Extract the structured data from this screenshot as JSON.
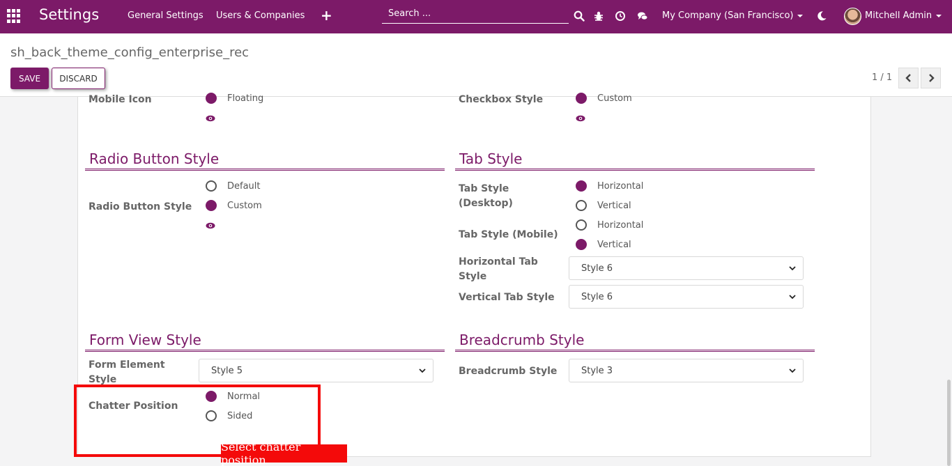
{
  "navbar": {
    "app_title": "Settings",
    "links": [
      "General Settings",
      "Users & Companies"
    ],
    "search_placeholder": "Search ...",
    "company": "My Company (San Francisco)",
    "user": "Mitchell Admin"
  },
  "control_panel": {
    "record_title": "sh_back_theme_config_enterprise_rec",
    "save_label": "SAVE",
    "discard_label": "DISCARD",
    "pager": "1 / 1"
  },
  "top_partial": {
    "left": {
      "label": "Mobile Icon",
      "option": "Floating"
    },
    "right": {
      "label": "Checkbox Style",
      "option": "Custom"
    }
  },
  "radio_section": {
    "title": "Radio Button Style",
    "label": "Radio Button Style",
    "options": [
      "Default",
      "Custom"
    ],
    "selected": "Custom"
  },
  "tab_section": {
    "title": "Tab Style",
    "desktop_label_1": "Tab Style",
    "desktop_label_2": "(Desktop)",
    "desktop_options": [
      "Horizontal",
      "Vertical"
    ],
    "desktop_selected": "Horizontal",
    "mobile_label": "Tab Style (Mobile)",
    "mobile_options": [
      "Horizontal",
      "Vertical"
    ],
    "mobile_selected": "Vertical",
    "horizontal_label_1": "Horizontal Tab",
    "horizontal_label_2": "Style",
    "horizontal_value": "Style 6",
    "vertical_label": "Vertical Tab Style",
    "vertical_value": "Style 6"
  },
  "form_section": {
    "title": "Form View Style",
    "element_label_1": "Form Element",
    "element_label_2": "Style",
    "element_value": "Style 5",
    "chatter_label": "Chatter Position",
    "chatter_options": [
      "Normal",
      "Sided"
    ],
    "chatter_selected": "Normal"
  },
  "breadcrumb_section": {
    "title": "Breadcrumb Style",
    "label": "Breadcrumb Style",
    "value": "Style 3"
  },
  "annotation": {
    "text": "Select chatter position",
    "color": "#f40a0a"
  },
  "colors": {
    "brand": "#7c1a68",
    "label": "#666666"
  }
}
